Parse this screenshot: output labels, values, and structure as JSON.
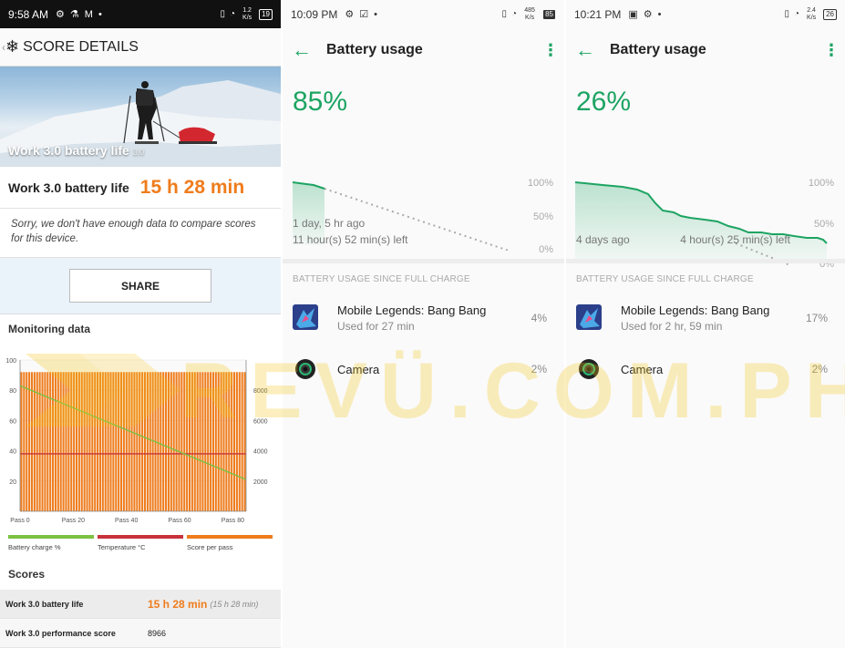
{
  "panel1": {
    "status": {
      "time": "9:58 AM",
      "net_speed": "1.2 K/s",
      "battery": "19"
    },
    "header": {
      "back": "‹",
      "title": "SCORE DETAILS"
    },
    "hero": {
      "title": "Work 3.0 battery life",
      "version": "3.0"
    },
    "result": {
      "label": "Work 3.0 battery life",
      "value": "15 h 28 min"
    },
    "note": "Sorry, we don't have enough data to compare scores for this device.",
    "share_label": "SHARE",
    "monitoring_title": "Monitoring data",
    "legend": [
      {
        "label": "Battery charge %",
        "color": "#7cc142"
      },
      {
        "label": "Temperature °C",
        "color": "#c8323a"
      },
      {
        "label": "Score per pass",
        "color": "#ef7c1c"
      }
    ],
    "scores_title": "Scores",
    "scores": [
      {
        "name": "Work 3.0 battery life",
        "value": "15 h 28 min",
        "sub": "(15 h 28 min)"
      },
      {
        "name": "Work 3.0 performance score",
        "value": "8966"
      }
    ]
  },
  "chart_data": {
    "type": "bar",
    "title": "Monitoring data",
    "x_ticks": [
      "Pass 0",
      "Pass 20",
      "Pass 40",
      "Pass 60",
      "Pass 80"
    ],
    "x_range": [
      0,
      85
    ],
    "left_axis": {
      "ticks": [
        "100",
        "80",
        "60",
        "40",
        "20"
      ],
      "range": [
        0,
        100
      ]
    },
    "right_axis": {
      "ticks": [
        "8000",
        "6000",
        "4000",
        "2000"
      ],
      "range": [
        0,
        10000
      ]
    },
    "series": [
      {
        "name": "Battery charge %",
        "color": "#7cc142",
        "type": "line",
        "points": [
          [
            0,
            83
          ],
          [
            85,
            21
          ]
        ]
      },
      {
        "name": "Temperature °C",
        "color": "#c8323a",
        "type": "line",
        "value": 38
      },
      {
        "name": "Score per pass",
        "color": "#ef7c1c",
        "type": "bar",
        "count": 86,
        "approx_value": 9200
      }
    ]
  },
  "panel2": {
    "status": {
      "time": "10:09 PM",
      "net_speed": "485 K/s",
      "battery": "85"
    },
    "title": "Battery usage",
    "percent": "85%",
    "axis": [
      "100%",
      "50%",
      "0%"
    ],
    "time_ago": "1 day, 5 hr ago",
    "time_left": "11 hour(s) 52 min(s) left",
    "section": "BATTERY USAGE SINCE FULL CHARGE",
    "apps": [
      {
        "name": "Mobile Legends: Bang Bang",
        "usage": "Used for 27 min",
        "pct": "4%",
        "icon": "game-icon"
      },
      {
        "name": "Camera",
        "usage": "",
        "pct": "2%",
        "icon": "camera-icon"
      }
    ]
  },
  "panel3": {
    "status": {
      "time": "10:21 PM",
      "net_speed": "2.4 K/s",
      "battery": "26"
    },
    "title": "Battery usage",
    "percent": "26%",
    "axis": [
      "100%",
      "50%",
      "0%"
    ],
    "time_ago": "4 days ago",
    "time_left": "4 hour(s) 25 min(s) left",
    "section": "BATTERY USAGE SINCE FULL CHARGE",
    "apps": [
      {
        "name": "Mobile Legends: Bang Bang",
        "usage": "Used for 2 hr, 59 min",
        "pct": "17%",
        "icon": "game-icon"
      },
      {
        "name": "Camera",
        "usage": "",
        "pct": "2%",
        "icon": "camera-icon"
      }
    ]
  },
  "watermark": "REVÜ.COM.PH",
  "colors": {
    "accent_green": "#1da462",
    "accent_orange": "#ef7c1c"
  }
}
